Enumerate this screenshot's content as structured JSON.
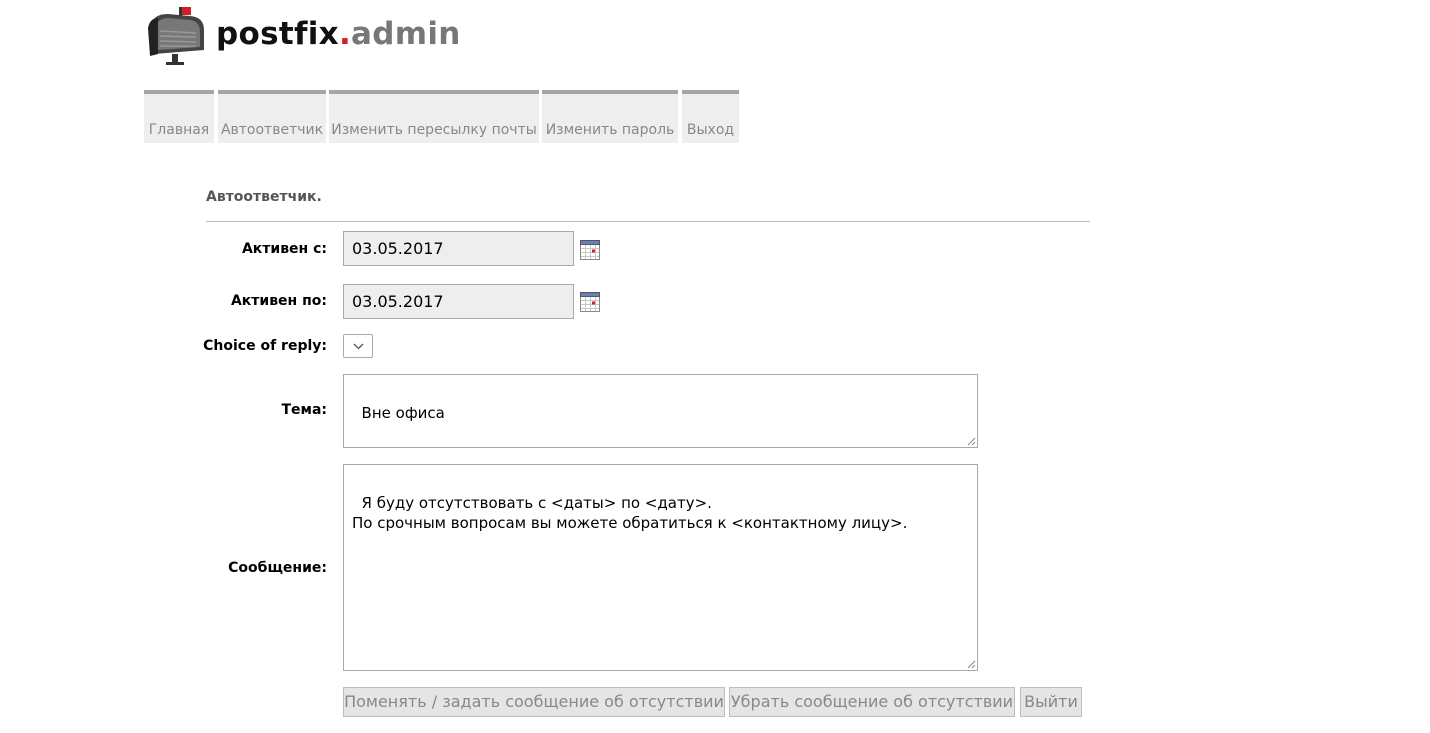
{
  "logo": {
    "part1": "postfix",
    "dot": ".",
    "part2": "admin"
  },
  "menu": [
    {
      "label": "Главная"
    },
    {
      "label": "Автоответчик"
    },
    {
      "label": "Изменить пересылку почты"
    },
    {
      "label": "Изменить пароль"
    },
    {
      "label": "Выход"
    }
  ],
  "page": {
    "title": "Автоответчик."
  },
  "form": {
    "active_from": {
      "label": "Активен с:",
      "value": "03.05.2017"
    },
    "active_to": {
      "label": "Активен по:",
      "value": "03.05.2017"
    },
    "reply_choice": {
      "label": "Choice of reply:"
    },
    "subject": {
      "label": "Тема:",
      "value": "Вне офиса"
    },
    "message": {
      "label": "Сообщение:",
      "value": "Я буду отсутствовать с <даты> по <дату>.\nПо срочным вопросам вы можете обратиться к <контактному лицу>."
    }
  },
  "buttons": {
    "set": "Поменять / задать сообщение об отсутствии",
    "remove": "Убрать сообщение об отсутствии",
    "exit": "Выйти"
  },
  "icons": {
    "calendar": "calendar-icon",
    "select": "chevron-down-icon",
    "logo": "mailbox-icon"
  },
  "colors": {
    "accent_red": "#d0202a",
    "menu_bg": "#eeeeee",
    "menu_border": "#a5a5a5"
  }
}
